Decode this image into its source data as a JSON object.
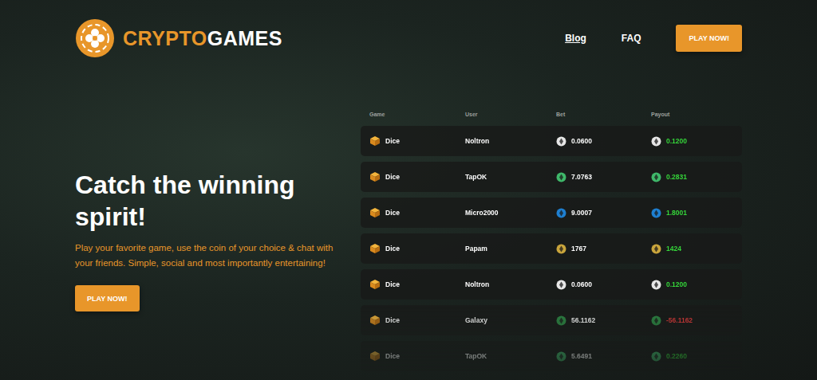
{
  "logo": {
    "brand_first": "CRYPTO",
    "brand_second": "GAMES"
  },
  "nav": [
    {
      "label": "Blog",
      "selected": true
    },
    {
      "label": "FAQ",
      "selected": false
    }
  ],
  "header_button": "PLAY NOW!",
  "hero": {
    "title": "Catch the winning spirit!",
    "text": "Play your favorite game, use the coin of your choice & chat with your friends. Simple, social and most importantly entertaining!",
    "button": "PLAY NOW!"
  },
  "table": {
    "columns": [
      "Game",
      "User",
      "Bet",
      "Payout"
    ],
    "rows": [
      {
        "game": "Dice",
        "user": "Noltron",
        "bet": "0.0600",
        "payout": "0.1200",
        "win": true,
        "color": "#e6e6e6"
      },
      {
        "game": "Dice",
        "user": "TapOK",
        "bet": "7.0763",
        "payout": "0.2831",
        "win": true,
        "color": "#3fb86a"
      },
      {
        "game": "Dice",
        "user": "Micro2000",
        "bet": "9.0007",
        "payout": "1.8001",
        "win": true,
        "color": "#1e7fd0"
      },
      {
        "game": "Dice",
        "user": "Papam",
        "bet": "1767",
        "payout": "1424",
        "win": true,
        "color": "#c9a53c"
      },
      {
        "game": "Dice",
        "user": "Noltron",
        "bet": "0.0600",
        "payout": "0.1200",
        "win": true,
        "color": "#e6e6e6"
      },
      {
        "game": "Dice",
        "user": "Galaxy",
        "bet": "56.1162",
        "payout": "-56.1162",
        "win": false,
        "color": "#2e8a45"
      },
      {
        "game": "Dice",
        "user": "TapOK",
        "bet": "5.6491",
        "payout": "0.2260",
        "win": true,
        "color": "#3fb86a"
      }
    ]
  }
}
